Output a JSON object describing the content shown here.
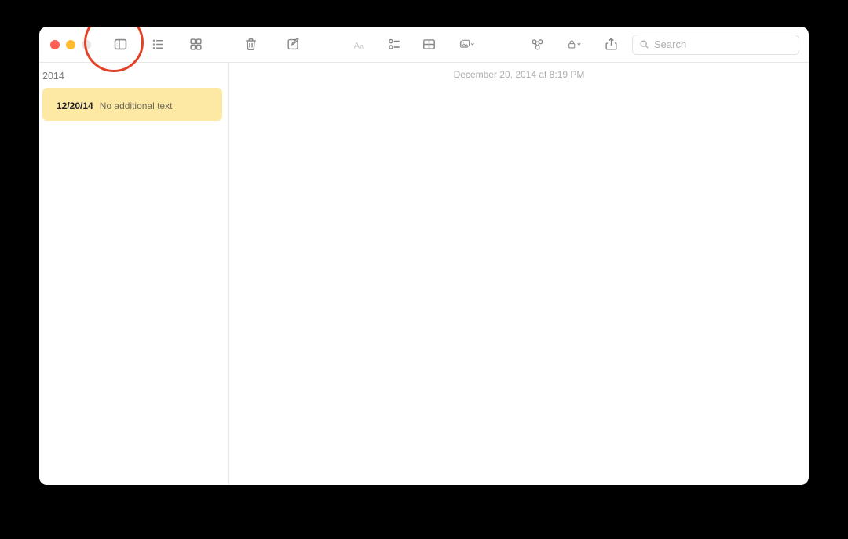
{
  "window": {
    "traffic": {
      "close": "",
      "min": "",
      "max": ""
    },
    "search_placeholder": "Search"
  },
  "sidebar": {
    "section_header": "2014",
    "notes": [
      {
        "title_glyph": "",
        "date": "12/20/14",
        "preview": "No additional text"
      }
    ]
  },
  "editor": {
    "timestamp": "December 20, 2014 at 8:19 PM",
    "body_glyph": ""
  }
}
